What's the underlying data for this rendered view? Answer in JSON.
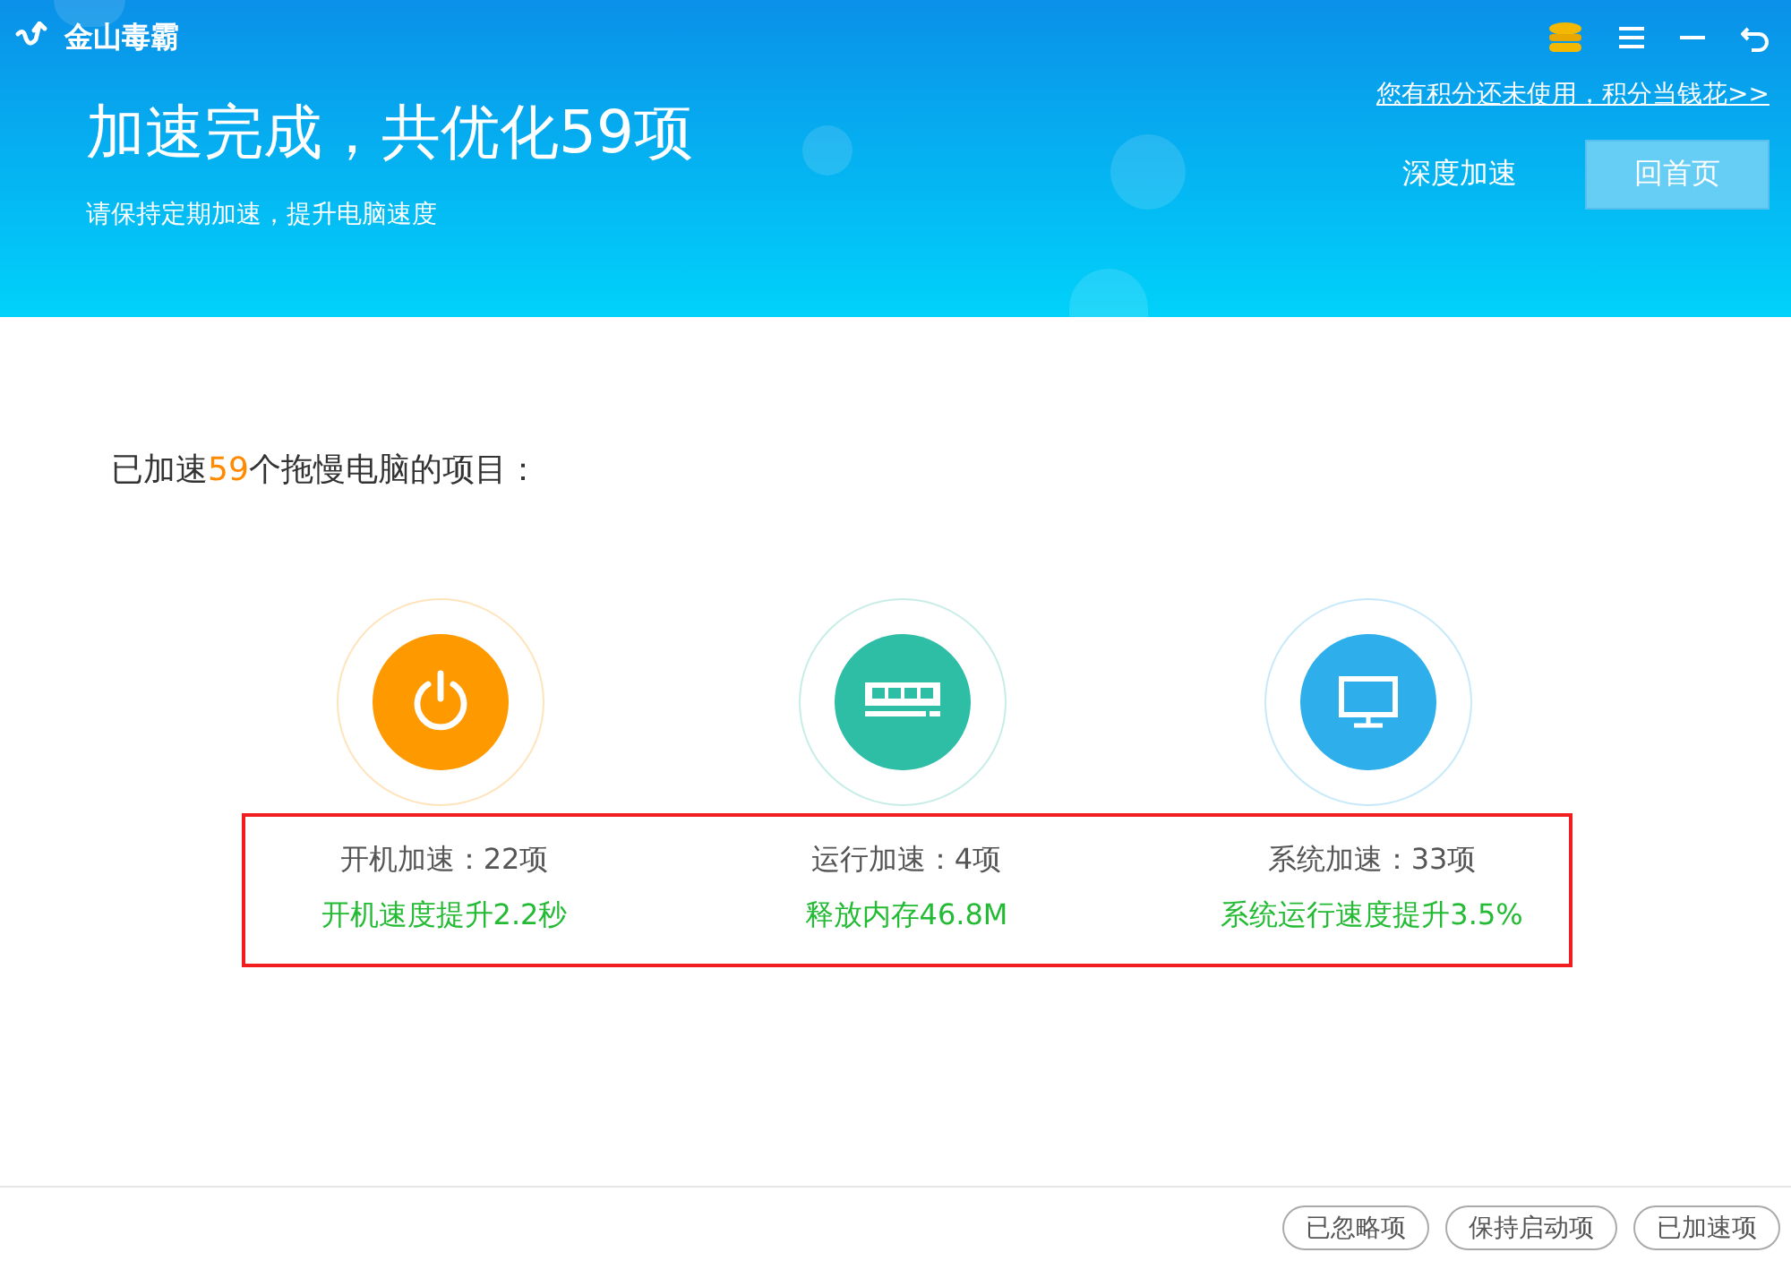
{
  "app": {
    "name": "金山毒霸"
  },
  "header": {
    "title": "加速完成，共优化59项",
    "subtitle": "请保持定期加速，提升电脑速度",
    "points_link": "您有积分还未使用，积分当钱花>>",
    "deep_button": "深度加速",
    "home_button": "回首页"
  },
  "summary": {
    "prefix": "已加速",
    "count": "59",
    "suffix": "个拖慢电脑的项目："
  },
  "categories": [
    {
      "kind": "power",
      "color": "#ff9900",
      "label": "开机加速：22项",
      "result": "开机速度提升2.2秒"
    },
    {
      "kind": "memory",
      "color": "#2ebda5",
      "label": "运行加速：4项",
      "result": "释放内存46.8M"
    },
    {
      "kind": "monitor",
      "color": "#2eaeea",
      "label": "系统加速：33项",
      "result": "系统运行速度提升3.5%"
    }
  ],
  "footer_buttons": [
    "已忽略项",
    "保持启动项",
    "已加速项"
  ]
}
